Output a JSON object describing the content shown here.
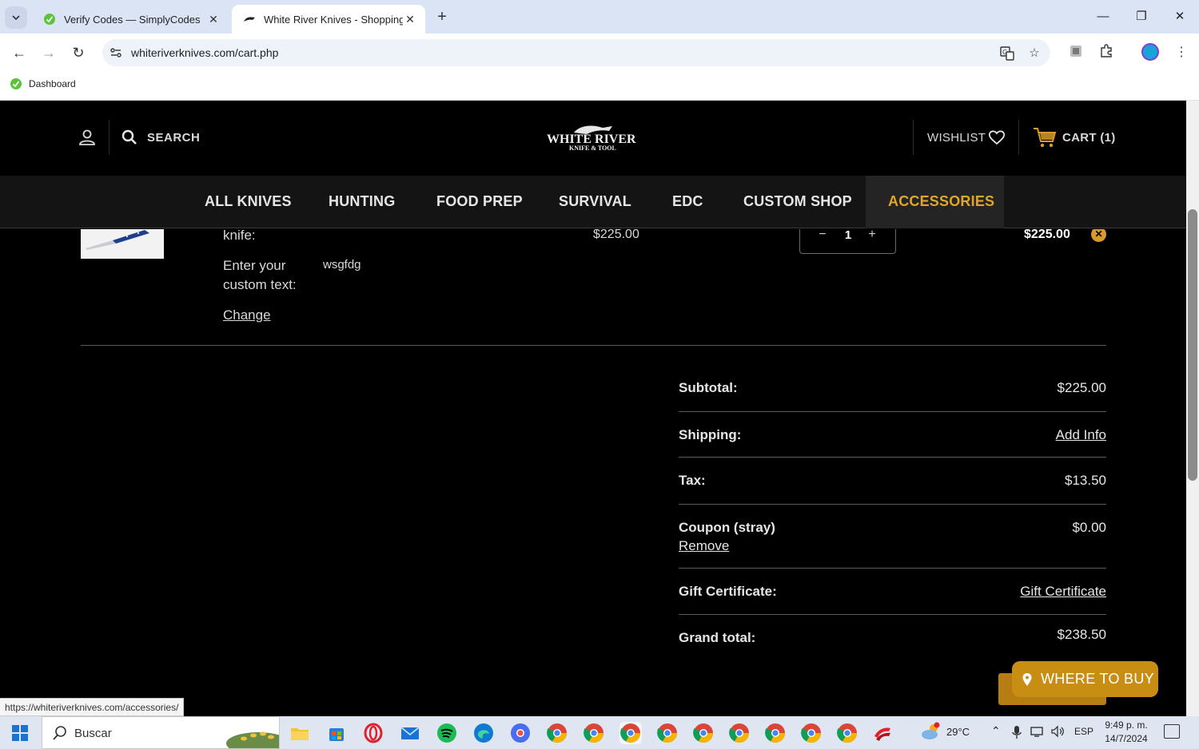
{
  "browser": {
    "tabs": [
      {
        "title": "Verify Codes — SimplyCodes",
        "active": false
      },
      {
        "title": "White River Knives - Shopping Cart",
        "active": true
      }
    ],
    "url": "whiteriverknives.com/cart.php",
    "bookmarks": [
      {
        "label": "Dashboard"
      }
    ],
    "status_url": "https://whiteriverknives.com/accessories/"
  },
  "header": {
    "search_label": "SEARCH",
    "logo_text": "WHITE RIVER",
    "logo_subtext": "KNIFE & TOOL",
    "wishlist_label": "WISHLIST",
    "cart_label": "CART (1)"
  },
  "nav": {
    "items": [
      "ALL KNIVES",
      "HUNTING",
      "FOOD PREP",
      "SURVIVAL",
      "EDC",
      "CUSTOM SHOP",
      "ACCESSORIES"
    ],
    "active": "ACCESSORIES"
  },
  "cart": {
    "item": {
      "label_fragment": "knife:",
      "price": "$225.00",
      "quantity": "1",
      "line_total": "$225.00",
      "option_label": "Enter your custom text:",
      "option_value": "wsgfdg",
      "change_label": "Change"
    },
    "totals": {
      "subtotal_label": "Subtotal:",
      "subtotal_value": "$225.00",
      "shipping_label": "Shipping:",
      "shipping_value": "Add Info",
      "tax_label": "Tax:",
      "tax_value": "$13.50",
      "coupon_label": "Coupon (stray)",
      "coupon_value": "$0.00",
      "coupon_remove": "Remove",
      "gift_label": "Gift Certificate:",
      "gift_value": "Gift Certificate",
      "grand_label": "Grand total:",
      "grand_value": "$238.50"
    },
    "where_to_buy": "WHERE TO BUY"
  },
  "taskbar": {
    "search_placeholder": "Buscar",
    "weather": "29°C",
    "language": "ESP",
    "time": "9:49 p. m.",
    "date": "14/7/2024"
  },
  "colors": {
    "accent": "#e0a52b",
    "button": "#c88e14",
    "background": "#000000"
  }
}
